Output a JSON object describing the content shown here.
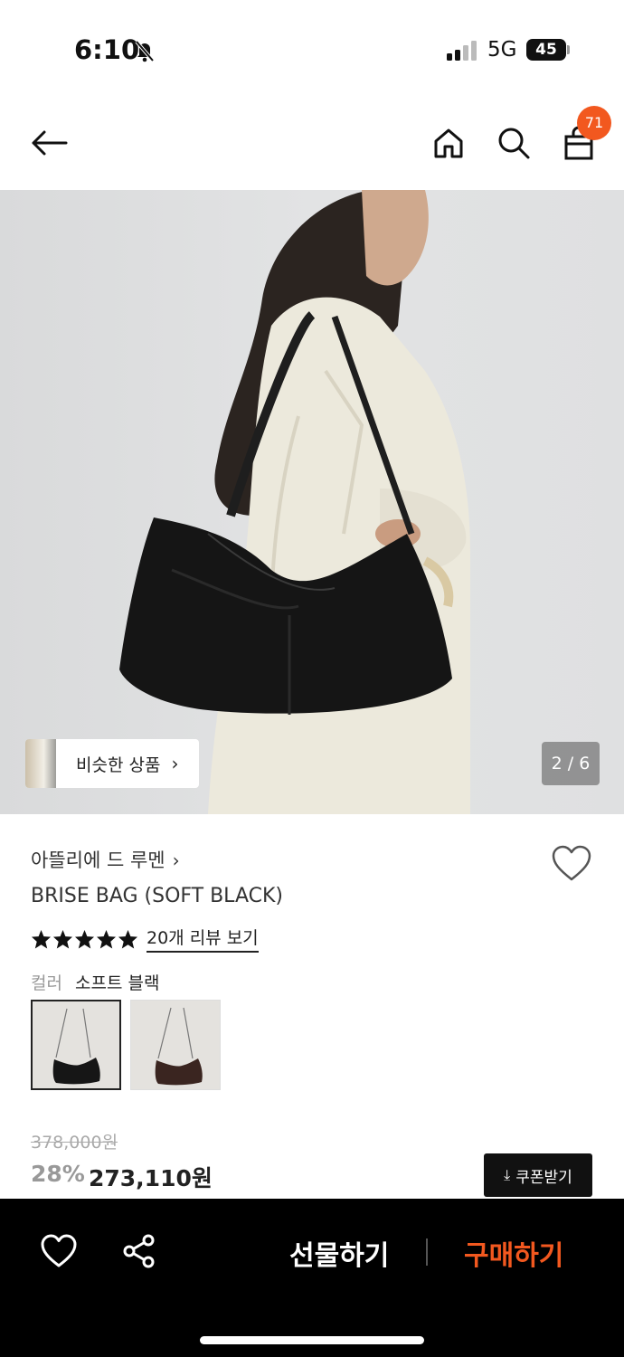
{
  "status_bar": {
    "time": "6:10",
    "network": "5G",
    "battery": "45"
  },
  "header": {
    "cart_count": "71"
  },
  "hero": {
    "similar_label": "비슷한 상품",
    "page_indicator": "2 / 6"
  },
  "product": {
    "brand": "아뜰리에 드 루멘",
    "name": "BRISE BAG (SOFT BLACK)",
    "rating_stars": 5,
    "review_link": "20개 리뷰 보기",
    "color_label": "컬러",
    "color_value": "소프트 블랙",
    "original_price": "378,000원",
    "discount": "28%",
    "sale_price": "273,110원",
    "coupon_label": "쿠폰받기"
  },
  "bottom_bar": {
    "gift_label": "선물하기",
    "buy_label": "구매하기"
  },
  "colors": {
    "accent": "#f2581f",
    "bar_bg": "#000000"
  }
}
